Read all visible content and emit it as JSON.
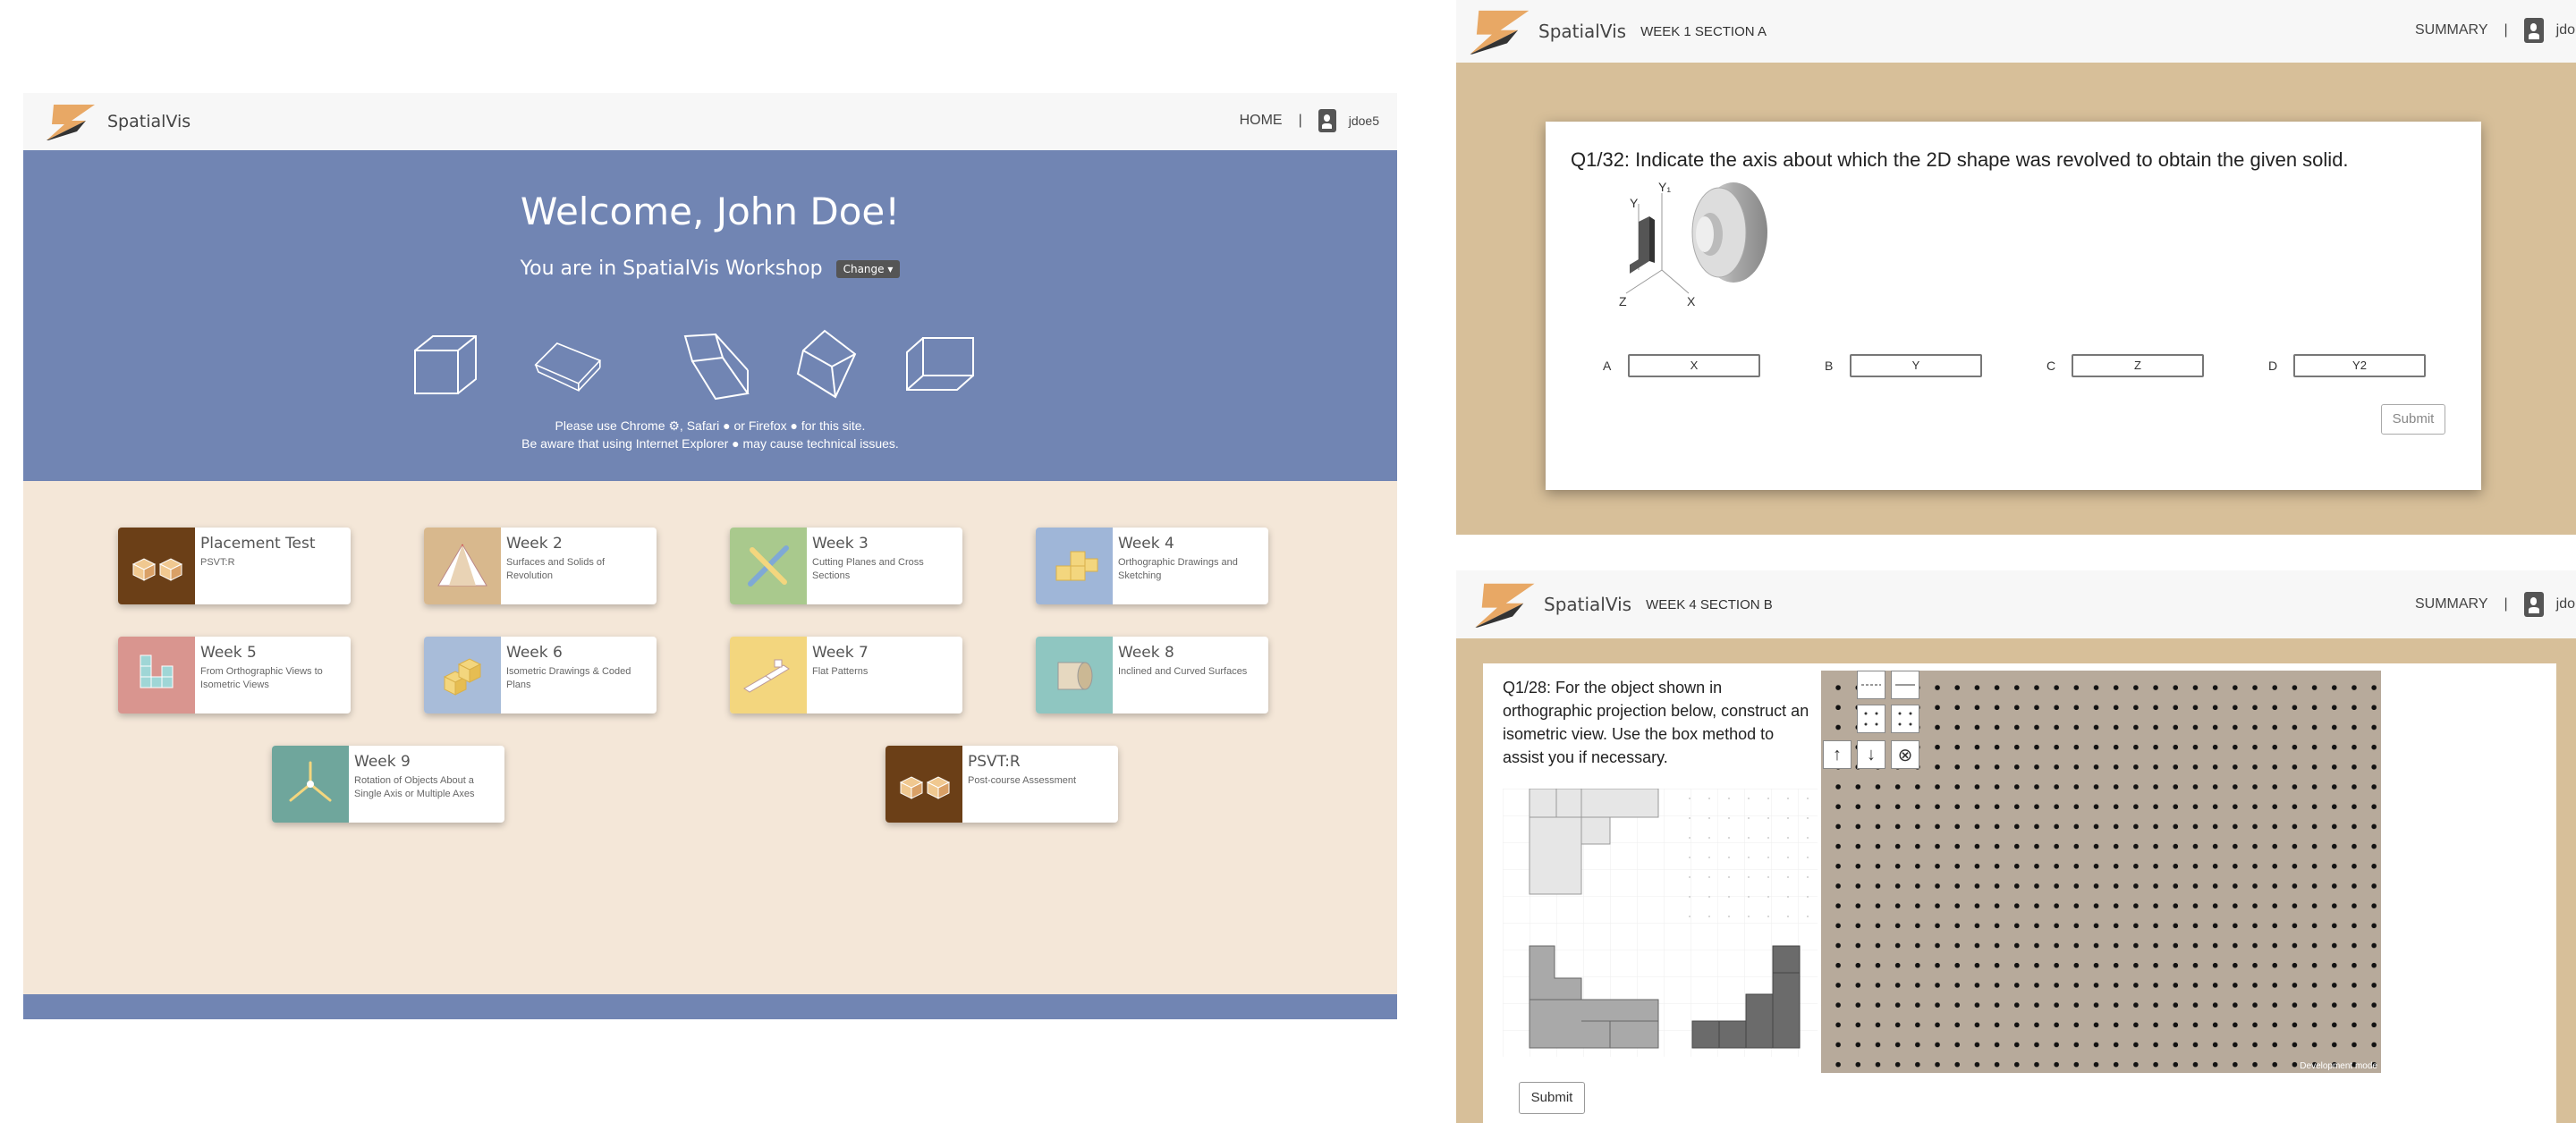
{
  "left": {
    "brand": "SpatialVis",
    "nav": {
      "home": "HOME",
      "separator": "|",
      "user": "jdoe5"
    },
    "hero": {
      "welcome": "Welcome, John Doe!",
      "workshop": "You are in SpatialVis Workshop",
      "change": "Change",
      "notice_line1": "Please use Chrome ⚙, Safari ● or Firefox ● for this site.",
      "notice_line2": "Be aware that using Internet Explorer ● may cause technical issues."
    },
    "cards": [
      {
        "title": "Placement Test",
        "subtitle": "PSVT:R",
        "color": "#6b3f17"
      },
      {
        "title": "Week 2",
        "subtitle": "Surfaces and Solids of Revolution",
        "color": "#d8b88d"
      },
      {
        "title": "Week 3",
        "subtitle": "Cutting Planes and Cross Sections",
        "color": "#a9c98d"
      },
      {
        "title": "Week 4",
        "subtitle": "Orthographic Drawings and Sketching",
        "color": "#9fb6d8"
      },
      {
        "title": "Week 5",
        "subtitle": "From Orthographic Views to Isometric Views",
        "color": "#d9958f"
      },
      {
        "title": "Week 6",
        "subtitle": "Isometric Drawings & Coded Plans",
        "color": "#a8bcd9"
      },
      {
        "title": "Week 7",
        "subtitle": "Flat Patterns",
        "color": "#f3d67e"
      },
      {
        "title": "Week 8",
        "subtitle": "Inclined and Curved Surfaces",
        "color": "#8fc6c1"
      },
      {
        "title": "Week 9",
        "subtitle": "Rotation of Objects About a Single Axis or Multiple Axes",
        "color": "#6fa69c"
      },
      {
        "title": "PSVT:R",
        "subtitle": "Post-course Assessment",
        "color": "#6b3f17"
      }
    ]
  },
  "right_top": {
    "brand": "SpatialVis",
    "crumb": "WEEK 1 SECTION A",
    "nav": {
      "summary": "SUMMARY",
      "separator": "|",
      "user": "jdo"
    },
    "question": "Q1/32: Indicate the axis about which the 2D shape was revolved to obtain the given solid.",
    "axis_labels": {
      "y": "Y",
      "y1": "Y₁",
      "z": "Z",
      "x": "X"
    },
    "options": [
      {
        "letter": "A",
        "value": "X"
      },
      {
        "letter": "B",
        "value": "Y"
      },
      {
        "letter": "C",
        "value": "Z"
      },
      {
        "letter": "D",
        "value": "Y2"
      }
    ],
    "submit": "Submit"
  },
  "right_bottom": {
    "brand": "SpatialVis",
    "crumb": "WEEK 4 SECTION B",
    "nav": {
      "summary": "SUMMARY",
      "separator": "|",
      "user": "jdo"
    },
    "question": "Q1/28: For the object shown in orthographic projection below, construct an isometric view. Use the box method to assist you if necessary.",
    "tools": {
      "up": "↑",
      "down": "↓",
      "clear": "⊗"
    },
    "dev_note": "Development mode",
    "submit": "Submit"
  }
}
